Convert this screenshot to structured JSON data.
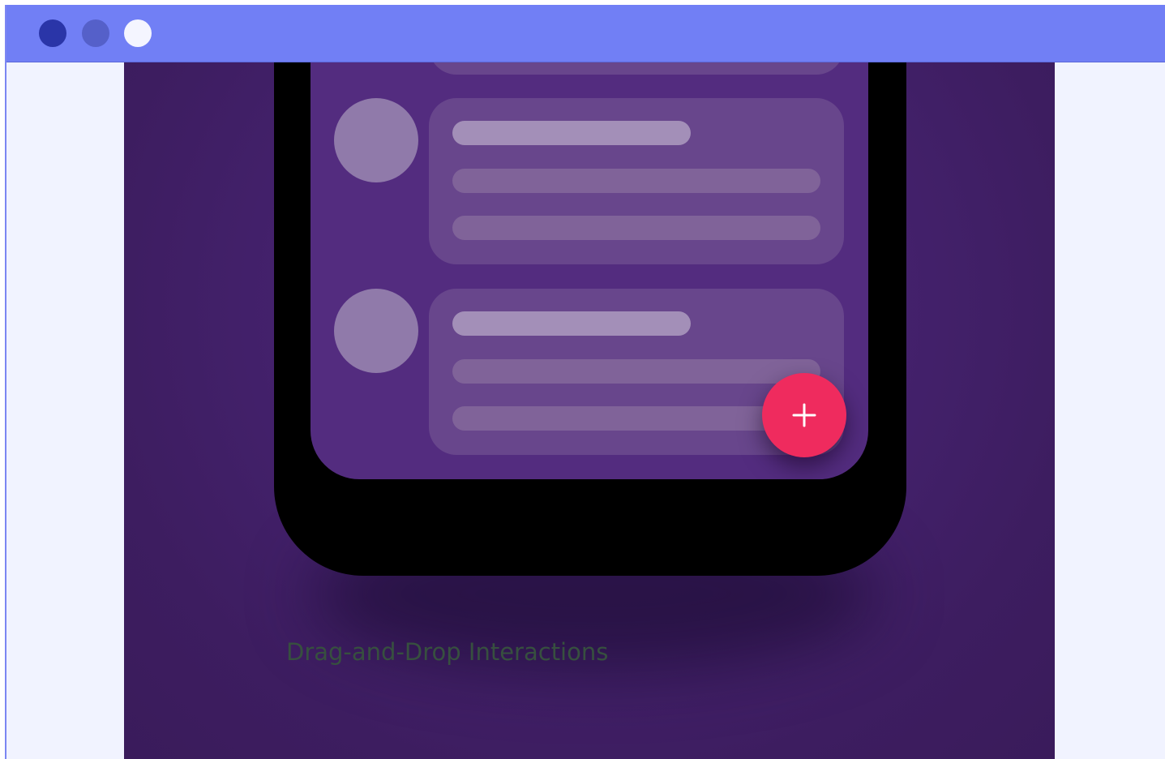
{
  "window": {
    "controls": [
      "close-dot-icon",
      "minimize-dot-icon",
      "maximize-dot-icon"
    ]
  },
  "content": {
    "caption": "Drag-and-Drop Interactions",
    "fab_icon": "plus-icon"
  },
  "colors": {
    "titlebar": "#717ff5",
    "window_background": "#f1f3ff",
    "viewport_background": "#45226f",
    "phone_frame": "#000000",
    "phone_screen": "#532c7f",
    "list_card": "#68468c",
    "avatar": "#907aaa",
    "fab": "#ef2b5e",
    "caption_text": "#37503f"
  }
}
